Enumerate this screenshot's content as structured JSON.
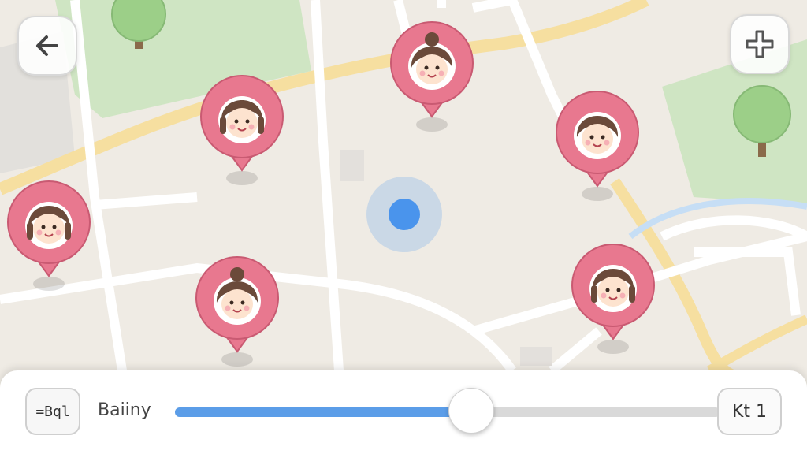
{
  "header": {
    "back_icon": "arrow-left-icon",
    "add_icon": "plus-icon"
  },
  "map": {
    "background_color": "#efebe4",
    "park_color": "#cfe5c3",
    "road_color": "#ffffff",
    "major_road_color": "#f6dfa0",
    "water_color": "#c6def5",
    "user_location_color": "#4a94ec",
    "pin_color": "#e8788f",
    "pins": [
      {
        "id": "friend-1",
        "icon": "avatar-girl-bun"
      },
      {
        "id": "friend-2",
        "icon": "avatar-girl-bob"
      },
      {
        "id": "friend-3",
        "icon": "avatar-boy"
      },
      {
        "id": "friend-4",
        "icon": "avatar-girl-bob"
      },
      {
        "id": "friend-5",
        "icon": "avatar-girl-bun"
      },
      {
        "id": "friend-6",
        "icon": "avatar-girl-long-hair"
      }
    ]
  },
  "bottom_panel": {
    "filter_button_label": "=Bql",
    "filter_label": "Baiiny",
    "slider_value_percent": 54,
    "slider_fill_color": "#5b9de8",
    "value_badge": "Kt 1"
  }
}
